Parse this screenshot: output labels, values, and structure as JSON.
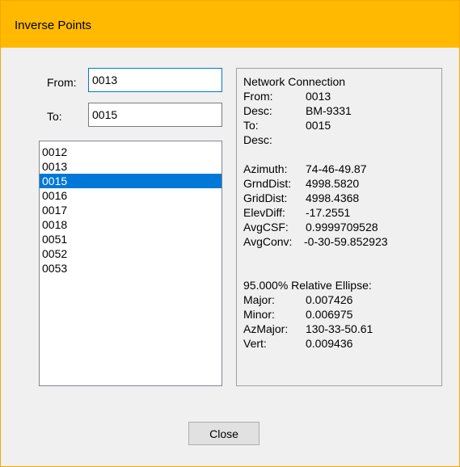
{
  "window": {
    "title": "Inverse Points",
    "accent_color": "#ffb900",
    "selection_color": "#0078d7"
  },
  "from": {
    "label": "From:",
    "value": "0013"
  },
  "to": {
    "label": "To:",
    "value": "0015"
  },
  "points": {
    "items": [
      "0012",
      "0013",
      "0015",
      "0016",
      "0017",
      "0018",
      "0051",
      "0052",
      "0053"
    ],
    "selected": "0015"
  },
  "info": {
    "header": "Network Connection",
    "from_key": "From:",
    "from_val": "0013",
    "desc1_key": "Desc:",
    "desc1_val": "BM-9331",
    "to_key": "To:",
    "to_val": "0015",
    "desc2_key": "Desc:",
    "desc2_val": "",
    "azimuth_key": "Azimuth:",
    "azimuth_val": "74-46-49.87",
    "grnddist_key": "GrndDist:",
    "grnddist_val": "4998.5820",
    "griddist_key": "GridDist:",
    "griddist_val": "4998.4368",
    "elevdiff_key": "ElevDiff:",
    "elevdiff_val": "-17.2551",
    "avgcsf_key": "AvgCSF:",
    "avgcsf_val": "0.9999709528",
    "avgconv_key": "AvgConv:",
    "avgconv_val": "-0-30-59.852923",
    "ellipse_header": "95.000% Relative Ellipse:",
    "major_key": "Major:",
    "major_val": "0.007426",
    "minor_key": "Minor:",
    "minor_val": "0.006975",
    "azmajor_key": "AzMajor:",
    "azmajor_val": "130-33-50.61",
    "vert_key": "Vert:",
    "vert_val": "0.009436"
  },
  "close_label": "Close"
}
